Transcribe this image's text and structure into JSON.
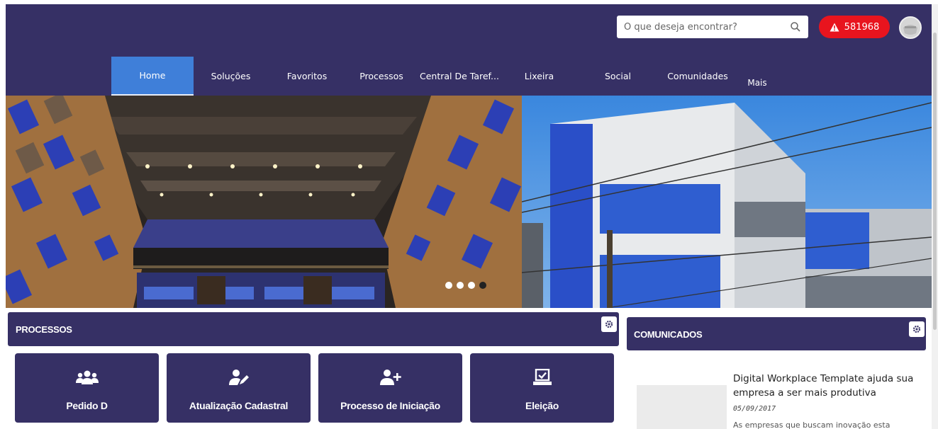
{
  "header": {
    "search": {
      "placeholder": "O que deseja encontrar?",
      "value": ""
    },
    "alert": {
      "count": "581968",
      "color": "#e8141e"
    },
    "avatar": "user-avatar",
    "background": "#363065"
  },
  "nav": {
    "accent": "#3f7fd9",
    "items": [
      {
        "label": "Home",
        "active": true
      },
      {
        "label": "Soluções"
      },
      {
        "label": "Favoritos"
      },
      {
        "label": "Processos"
      },
      {
        "label": "Central De Taref..."
      },
      {
        "label": "Lixeira"
      },
      {
        "label": "Social"
      },
      {
        "label": "Comunidades"
      },
      {
        "label": "Mais"
      }
    ]
  },
  "carousel": {
    "slides": 4,
    "active_slide": 3
  },
  "processes": {
    "title": "PROCESSOS",
    "cards": [
      {
        "label": "Pedido D",
        "icon": "users-icon"
      },
      {
        "label": "Atualização Cadastral",
        "icon": "user-edit-icon"
      },
      {
        "label": "Processo de Iniciação",
        "icon": "user-plus-icon"
      },
      {
        "label": "Eleição",
        "icon": "ballot-icon"
      }
    ]
  },
  "announcements": {
    "title": "COMUNICADOS",
    "news": [
      {
        "title": "Digital Workplace Template ajuda sua empresa a ser mais produtiva",
        "date": "05/09/2017",
        "excerpt": "As empresas que buscam inovação esta"
      }
    ]
  }
}
